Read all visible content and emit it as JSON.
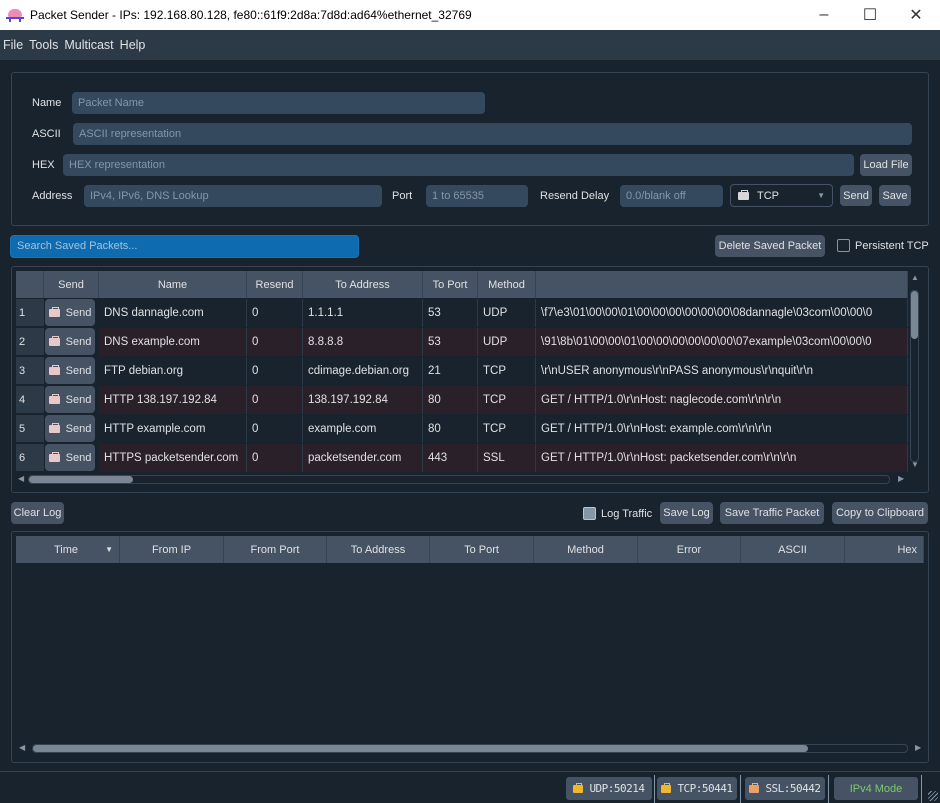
{
  "window": {
    "title": "Packet Sender - IPs: 192.168.80.128, fe80::61f9:2d8a:7d8d:ad64%ethernet_32769",
    "controls": {
      "minimize": "–",
      "maximize": "☐",
      "close": "✕"
    }
  },
  "menu": [
    "File",
    "Tools",
    "Multicast",
    "Help"
  ],
  "form": {
    "name_label": "Name",
    "name_placeholder": "Packet Name",
    "ascii_label": "ASCII",
    "ascii_placeholder": "ASCII representation",
    "hex_label": "HEX",
    "hex_placeholder": "HEX representation",
    "load_file": "Load File",
    "address_label": "Address",
    "address_placeholder": "IPv4, IPv6, DNS Lookup",
    "port_label": "Port",
    "port_placeholder": "1 to 65535",
    "resend_label": "Resend Delay",
    "resend_placeholder": "0.0/blank off",
    "protocol": "TCP",
    "send": "Send",
    "save": "Save"
  },
  "saved": {
    "search_placeholder": "Search Saved Packets...",
    "delete_button": "Delete Saved Packet",
    "persistent_tcp": "Persistent TCP",
    "columns": [
      "Send",
      "Name",
      "Resend",
      "To Address",
      "To Port",
      "Method",
      ""
    ],
    "send_label": "Send",
    "rows": [
      {
        "num": "1",
        "name": "DNS dannagle.com",
        "resend": "0",
        "address": "1.1.1.1",
        "port": "53",
        "method": "UDP",
        "data": "\\f7\\e3\\01\\00\\00\\01\\00\\00\\00\\00\\00\\00\\08dannagle\\03com\\00\\00\\0"
      },
      {
        "num": "2",
        "name": "DNS example.com",
        "resend": "0",
        "address": "8.8.8.8",
        "port": "53",
        "method": "UDP",
        "data": "\\91\\8b\\01\\00\\00\\01\\00\\00\\00\\00\\00\\00\\07example\\03com\\00\\00\\0"
      },
      {
        "num": "3",
        "name": "FTP debian.org",
        "resend": "0",
        "address": "cdimage.debian.org",
        "port": "21",
        "method": "TCP",
        "data": "\\r\\nUSER anonymous\\r\\nPASS anonymous\\r\\nquit\\r\\n"
      },
      {
        "num": "4",
        "name": "HTTP 138.197.192.84",
        "resend": "0",
        "address": "138.197.192.84",
        "port": "80",
        "method": "TCP",
        "data": "GET / HTTP/1.0\\r\\nHost: naglecode.com\\r\\n\\r\\n"
      },
      {
        "num": "5",
        "name": "HTTP example.com",
        "resend": "0",
        "address": "example.com",
        "port": "80",
        "method": "TCP",
        "data": "GET / HTTP/1.0\\r\\nHost: example.com\\r\\n\\r\\n"
      },
      {
        "num": "6",
        "name": "HTTPS packetsender.com",
        "resend": "0",
        "address": "packetsender.com",
        "port": "443",
        "method": "SSL",
        "data": "GET / HTTP/1.0\\r\\nHost: packetsender.com\\r\\n\\r\\n"
      }
    ]
  },
  "log": {
    "clear": "Clear Log",
    "log_traffic": "Log Traffic",
    "save_log": "Save Log",
    "save_traffic_packet": "Save Traffic Packet",
    "copy_clipboard": "Copy to Clipboard",
    "columns": [
      "Time",
      "From IP",
      "From Port",
      "To Address",
      "To Port",
      "Method",
      "Error",
      "ASCII",
      "Hex"
    ]
  },
  "status": {
    "udp": "UDP:50214",
    "tcp": "TCP:50441",
    "ssl": "SSL:50442",
    "mode": "IPv4 Mode"
  },
  "colors": {
    "row_even": "#19232d",
    "row_odd": "#2a2029",
    "accent": "#1a72bb",
    "mode_text": "#7ccc6a"
  }
}
